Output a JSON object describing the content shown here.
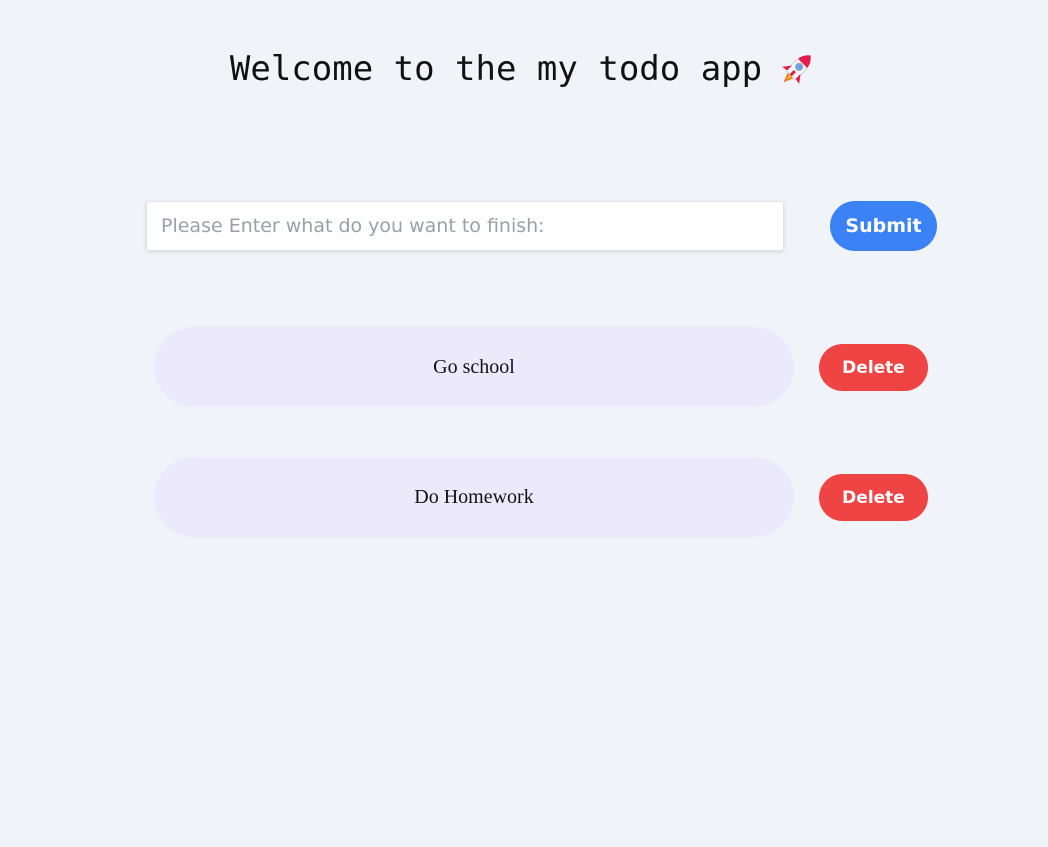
{
  "header": {
    "title": "Welcome to the my todo app",
    "icon": "rocket-icon"
  },
  "form": {
    "placeholder": "Please Enter what do you want to finish:",
    "value": "",
    "submit_label": "Submit"
  },
  "todos": [
    {
      "text": "Go school",
      "delete_label": "Delete"
    },
    {
      "text": "Do Homework",
      "delete_label": "Delete"
    }
  ],
  "colors": {
    "background": "#f0f3f8",
    "submit": "#3b82f6",
    "delete": "#ef4444",
    "todo_pill": "#ede9fd"
  }
}
